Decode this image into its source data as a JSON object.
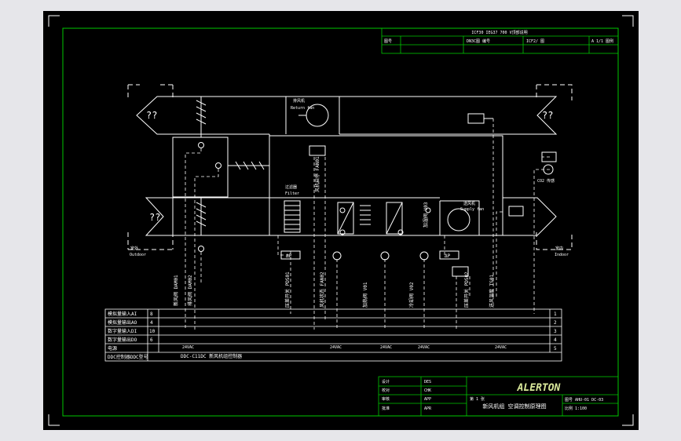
{
  "title_block_top": {
    "header": "ICF30 IEG37 700 V顶部说明",
    "cells": [
      "图号",
      "DN3C图 编号",
      "ICF2/ 图",
      "A 1/1 图例"
    ]
  },
  "labels": {
    "exhaust_unknown": "??",
    "supply_unknown": "??",
    "exhaust_fan": "排风机",
    "exhaust_fan_en": "Return fan",
    "supply_fan": "送风机",
    "supply_fan_en": "Supply fan",
    "filter": "过滤器",
    "filter_en": "Filter",
    "outdoor": "室外",
    "outdoor_en": "Outdoor",
    "indoor": "室内",
    "indoor_en": "Indoor",
    "co2_sensor": "CO2 传感",
    "dp": "ΔP",
    "outdoor_unknown": "??"
  },
  "vertical_tags": [
    "新风阀 DAM01",
    "排风阀 DAM02",
    "压差开关 PDS01",
    "风机启停 FAN01",
    "风机状态 FAN02",
    "加热阀 V01",
    "冷却阀 V02",
    "加湿阀 V03",
    "压差开关 PDS02",
    "送风温度 TS01"
  ],
  "io_table": {
    "rows": [
      {
        "label": "模拟量输入AI",
        "count": "8",
        "end": "1"
      },
      {
        "label": "模拟量输出AO",
        "count": "4",
        "end": "2"
      },
      {
        "label": "数字量输入DI",
        "count": "10",
        "end": "3"
      },
      {
        "label": "数字量输出DO",
        "count": "6",
        "end": "4"
      },
      {
        "label": "电源",
        "count": "",
        "end": "5"
      },
      {
        "label": "DDC控制器DDC型号",
        "count": "",
        "end": ""
      }
    ],
    "power_marks": [
      "24VAC",
      "24VAC",
      "24VAC",
      "24VAC",
      "24VAC"
    ],
    "ddc_model": "DDC-C11DC 新风机组控制器"
  },
  "title_block": {
    "left_cells": [
      "设计",
      "校对",
      "审核",
      "批准"
    ],
    "left_values": [
      "DES",
      "CHK",
      "APP",
      "APR"
    ],
    "logo": "ALERTON",
    "drawing_title": "新风机组 空调控制原理图",
    "right_meta": [
      "图号 AHU-01 DC-03",
      "比例 1:100"
    ],
    "sheet": "第 1 张"
  },
  "colors": {
    "background": "#000000",
    "line": "#ffffff",
    "frame": "#00c800",
    "outer": "#e6e6ea"
  }
}
